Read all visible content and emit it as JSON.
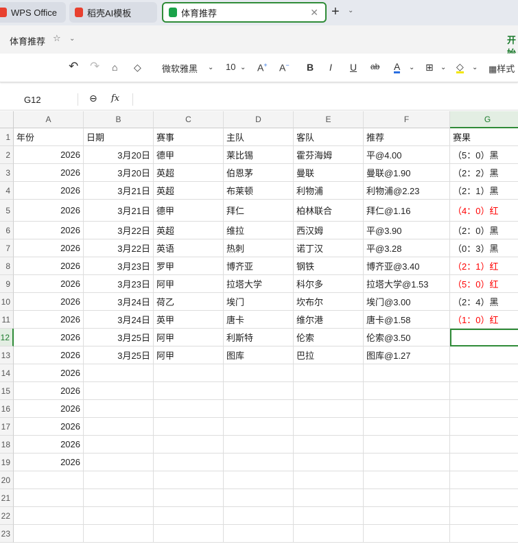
{
  "tabs": [
    {
      "label": "WPS Office",
      "icon": "wps-logo-icon",
      "color": "#e8402f"
    },
    {
      "label": "稻壳AI模板",
      "icon": "docer-logo-icon",
      "color": "#e8402f"
    },
    {
      "label": "体育推荐",
      "icon": "spreadsheet-icon",
      "color": "#1aa34a",
      "active": true
    }
  ],
  "doc": {
    "title": "体育推荐",
    "ribbon_tab": "开始"
  },
  "toolbar": {
    "font": "微软雅黑",
    "size": "10",
    "style_label": "样式"
  },
  "formula": {
    "cell_ref": "G12",
    "fx": "fx",
    "value": ""
  },
  "columns": [
    "A",
    "B",
    "C",
    "D",
    "E",
    "F",
    "G"
  ],
  "header_row": [
    "年份",
    "日期",
    "赛事",
    "主队",
    "客队",
    "推荐",
    "赛果"
  ],
  "rows": [
    {
      "year": "2026",
      "date": "3月20日",
      "league": "德甲",
      "home": "莱比锡",
      "away": "霍芬海姆",
      "pick": "平@4.00",
      "result": "（5：0）黑",
      "hit": false
    },
    {
      "year": "2026",
      "date": "3月20日",
      "league": "英超",
      "home": "伯恩茅",
      "away": "曼联",
      "pick": "曼联@1.90",
      "result": "（2：2）黑",
      "hit": false
    },
    {
      "year": "2026",
      "date": "3月21日",
      "league": "英超",
      "home": "布莱顿",
      "away": "利物浦",
      "pick": "利物浦@2.23",
      "result": "（2：1）黑",
      "hit": false
    },
    {
      "year": "2026",
      "date": "3月21日",
      "league": "德甲",
      "home": "拜仁",
      "away": "柏林联合",
      "pick": "拜仁@1.16",
      "result": "（4：0）红",
      "hit": true
    },
    {
      "year": "2026",
      "date": "3月22日",
      "league": "英超",
      "home": "维拉",
      "away": "西汉姆",
      "pick": "平@3.90",
      "result": "（2：0）黑",
      "hit": false
    },
    {
      "year": "2026",
      "date": "3月22日",
      "league": "英语",
      "home": "热刺",
      "away": "诺丁汉",
      "pick": "平@3.28",
      "result": "（0：3）黑",
      "hit": false
    },
    {
      "year": "2026",
      "date": "3月23日",
      "league": "罗甲",
      "home": "博齐亚",
      "away": "钢铁",
      "pick": "博齐亚@3.40",
      "result": "（2：1）红",
      "hit": true
    },
    {
      "year": "2026",
      "date": "3月23日",
      "league": "阿甲",
      "home": "拉塔大学",
      "away": "科尔多",
      "pick": "拉塔大学@1.53",
      "result": "（5：0）红",
      "hit": true
    },
    {
      "year": "2026",
      "date": "3月24日",
      "league": "荷乙",
      "home": "埃门",
      "away": "坎布尔",
      "pick": "埃门@3.00",
      "result": "（2：4）黑",
      "hit": false
    },
    {
      "year": "2026",
      "date": "3月24日",
      "league": "英甲",
      "home": "唐卡",
      "away": "维尔港",
      "pick": "唐卡@1.58",
      "result": "（1：0）红",
      "hit": true
    },
    {
      "year": "2026",
      "date": "3月25日",
      "league": "阿甲",
      "home": "利斯特",
      "away": "伦索",
      "pick": "伦索@3.50",
      "result": "",
      "hit": false
    },
    {
      "year": "2026",
      "date": "3月25日",
      "league": "阿甲",
      "home": "图库",
      "away": "巴拉",
      "pick": "图库@1.27",
      "result": "",
      "hit": false
    },
    {
      "year": "2026"
    },
    {
      "year": "2026"
    },
    {
      "year": "2026"
    },
    {
      "year": "2026"
    },
    {
      "year": "2026"
    },
    {
      "year": "2026"
    },
    {},
    {},
    {},
    {}
  ],
  "colors": {
    "accent": "#2e8b37",
    "hit": "#ff0000"
  }
}
